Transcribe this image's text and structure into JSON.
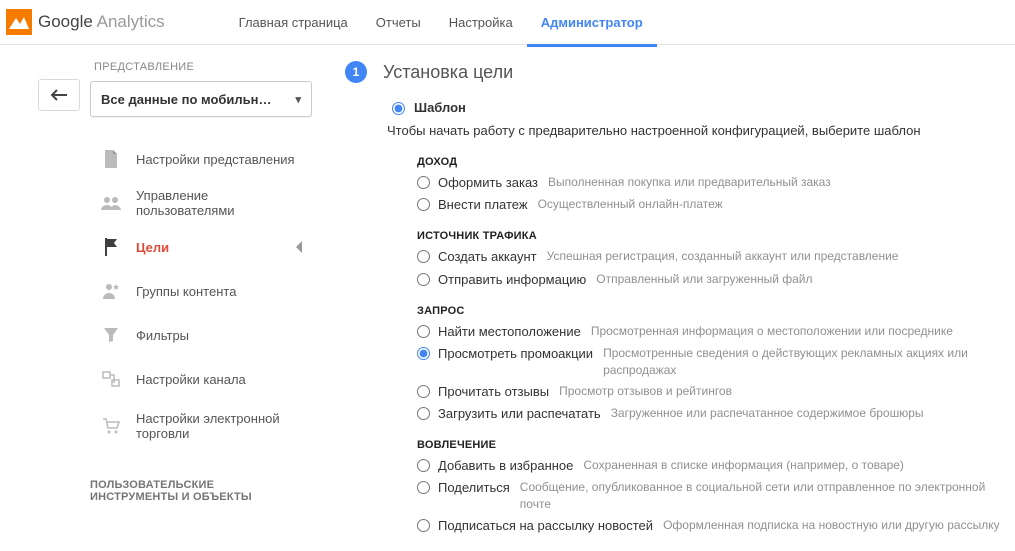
{
  "header": {
    "logo_bold": "Google",
    "logo_light": " Analytics",
    "nav": {
      "home": "Главная страница",
      "reports": "Отчеты",
      "config": "Настройка",
      "admin": "Администратор"
    }
  },
  "sidebar": {
    "section_label": "ПРЕДСТАВЛЕНИЕ",
    "view_value": "Все данные по мобильн…",
    "items": [
      {
        "label": "Настройки представления"
      },
      {
        "label": "Управление пользователями"
      },
      {
        "label": "Цели"
      },
      {
        "label": "Группы контента"
      },
      {
        "label": "Фильтры"
      },
      {
        "label": "Настройки канала"
      },
      {
        "label": "Настройки электронной торговли"
      }
    ],
    "footer": "ПОЛЬЗОВАТЕЛЬСКИЕ ИНСТРУМЕНТЫ И ОБЪЕКТЫ"
  },
  "main": {
    "step_number": "1",
    "step_title": "Установка цели",
    "template_label": "Шаблон",
    "template_desc": "Чтобы начать работу с предварительно настроенной конфигурацией, выберите шаблон",
    "groups": [
      {
        "title": "ДОХОД",
        "options": [
          {
            "name": "Оформить заказ",
            "hint": "Выполненная покупка или предварительный заказ"
          },
          {
            "name": "Внести платеж",
            "hint": "Осуществленный онлайн-платеж"
          }
        ]
      },
      {
        "title": "ИСТОЧНИК ТРАФИКА",
        "options": [
          {
            "name": "Создать аккаунт",
            "hint": "Успешная регистрация, созданный аккаунт или представление"
          },
          {
            "name": "Отправить информацию",
            "hint": "Отправленный или загруженный файл"
          }
        ]
      },
      {
        "title": "ЗАПРОС",
        "options": [
          {
            "name": "Найти местоположение",
            "hint": "Просмотренная информация о местоположении или посреднике"
          },
          {
            "name": "Просмотреть промоакции",
            "hint": "Просмотренные сведения о действующих рекламных акциях или распродажах",
            "checked": true
          },
          {
            "name": "Прочитать отзывы",
            "hint": "Просмотр отзывов и рейтингов"
          },
          {
            "name": "Загрузить или распечатать",
            "hint": "Загруженное или распечатанное содержимое брошюры"
          }
        ]
      },
      {
        "title": "ВОВЛЕЧЕНИЕ",
        "options": [
          {
            "name": "Добавить в избранное",
            "hint": "Сохраненная в списке информация (например, о товаре)"
          },
          {
            "name": "Поделиться",
            "hint": "Сообщение, опубликованное в социальной сети или отправленное по электронной почте"
          },
          {
            "name": "Подписаться на рассылку новостей",
            "hint": "Оформленная подписка на новостную или другую рассылку"
          }
        ]
      }
    ]
  }
}
